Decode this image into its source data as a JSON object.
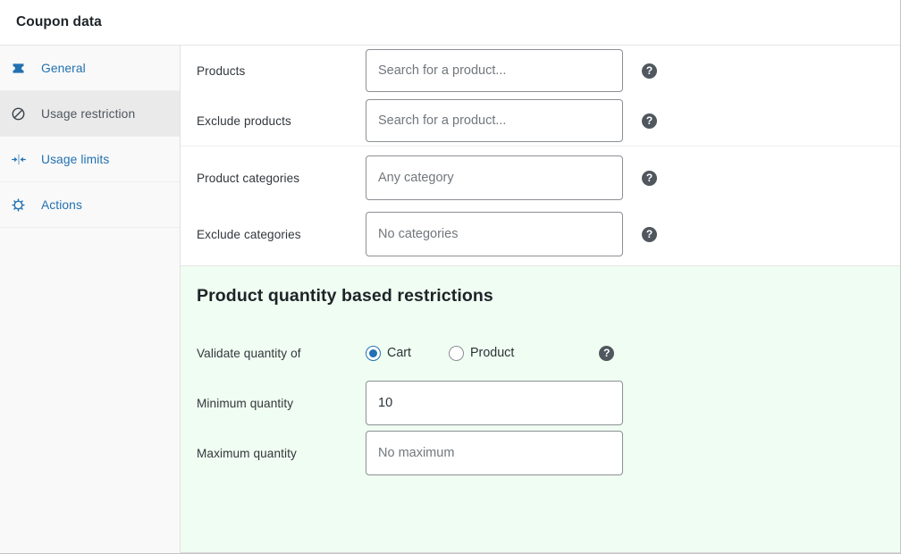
{
  "header": {
    "title": "Coupon data"
  },
  "sidebar": {
    "items": [
      {
        "label": "General",
        "icon": "coupon-ticket-icon",
        "active": false
      },
      {
        "label": "Usage restriction",
        "icon": "no-entry-icon",
        "active": true
      },
      {
        "label": "Usage limits",
        "icon": "limits-arrows-icon",
        "active": false
      },
      {
        "label": "Actions",
        "icon": "gear-icon",
        "active": false
      }
    ]
  },
  "main": {
    "products_group": {
      "rows": [
        {
          "label": "Products",
          "placeholder": "Search for a product...",
          "value": "",
          "help": "?"
        },
        {
          "label": "Exclude products",
          "placeholder": "Search for a product...",
          "value": "",
          "help": "?"
        }
      ]
    },
    "categories_group": {
      "rows": [
        {
          "label": "Product categories",
          "placeholder": "Any category",
          "value": "",
          "help": "?"
        },
        {
          "label": "Exclude categories",
          "placeholder": "No categories",
          "value": "",
          "help": "?"
        }
      ]
    },
    "quantity_section": {
      "heading": "Product quantity based restrictions",
      "background_color": "#f0fdf2",
      "validate_row": {
        "label": "Validate quantity of",
        "help": "?",
        "options": [
          {
            "label": "Cart",
            "checked": true
          },
          {
            "label": "Product",
            "checked": false
          }
        ]
      },
      "rows": [
        {
          "label": "Minimum quantity",
          "placeholder": "",
          "value": "10"
        },
        {
          "label": "Maximum quantity",
          "placeholder": "No maximum",
          "value": ""
        }
      ]
    }
  },
  "colors": {
    "link": "#2271b1",
    "active_tab_bg": "#eaeaea",
    "sidebar_bg": "#f9f9f9",
    "help_bg": "#50575e",
    "radio_accent": "#2271b1"
  }
}
